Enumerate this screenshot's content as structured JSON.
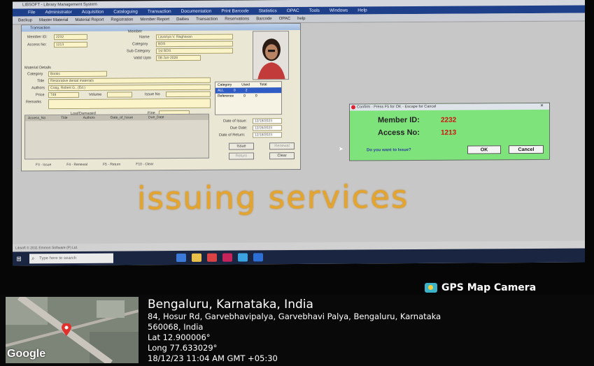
{
  "app": {
    "title": "LIBSOFT - Library Management System",
    "menu": [
      "File",
      "Administrator",
      "Acquisition",
      "Cataloguing",
      "Transaction",
      "Documentation",
      "Print Barcode",
      "Statistics",
      "OPAC",
      "Tools",
      "Windows",
      "Help"
    ],
    "toolbar": [
      "Backup",
      "Master Material",
      "Material Report",
      "Registration",
      "Member Report",
      "Dailies",
      "Transaction",
      "Reservations",
      "Barcode",
      "OPAC",
      "help"
    ],
    "status": "Libsoft © 2011 Emmon Software (P) Ltd."
  },
  "issue_window": {
    "title": "Transaction",
    "member_label": "Member",
    "member_id_label": "Member ID:",
    "member_id": "2232",
    "access_no_label": "Access No:",
    "access_no": "1213",
    "name_label": "Name",
    "name": "Lavanya V. Raghavan",
    "category_label": "Category",
    "category": "BDS",
    "subcategory_label": "Sub Category",
    "subcategory": "1st BDS",
    "valid_upto_label": "Valid Upto",
    "valid_upto": "08-Jun-2028",
    "material_details": "Material Details",
    "m_category_label": "Category",
    "m_category": "Books",
    "title_label": "Title",
    "book_title": "Restorative dental materials",
    "authors_label": "Authors",
    "authors": "Craig, Robert G., (Ed.)",
    "price_label": "Price",
    "price": "749",
    "volume_label": "Volume",
    "issue_no_label": "Issue No",
    "remarks_label": "Remarks",
    "lost_label": "Lost/Damaged",
    "fine_label": "Fine",
    "grid_headers": [
      "Access_No",
      "Title",
      "Authors",
      "Date_of_Issue",
      "Due_Date"
    ],
    "cat_headers": [
      "Category",
      "Used",
      "Total"
    ],
    "cat_rows": [
      [
        "ALL",
        "0",
        "2"
      ],
      [
        "Reference",
        "0",
        "0"
      ]
    ],
    "date_issue_label": "Date of Issue:",
    "date_issue": "12/18/2023",
    "due_date_label": "Due Date:",
    "due_date": "12/26/2023",
    "date_return_label": "Date of Return:",
    "date_return": "12/18/2023",
    "btn_issue": "Issue",
    "btn_renewal": "Renewal",
    "btn_return": "Return",
    "btn_clear": "Clear",
    "fkeys": [
      "F3 - Issue",
      "F4 - Renewal",
      "F5 - Return",
      "F10 - Clear"
    ]
  },
  "confirm": {
    "title": "Confirm - Press F5 for OK - Escape for Cancel",
    "member_id_label": "Member ID:",
    "member_id": "2232",
    "access_no_label": "Access No:",
    "access_no": "1213",
    "question": "Do you want to Issue?",
    "ok": "OK",
    "cancel": "Cancel"
  },
  "caption": "issuing services",
  "taskbar": {
    "search_placeholder": "Type here to search"
  },
  "gps": {
    "brand": "GPS Map Camera",
    "city": "Bengaluru, Karnataka, India",
    "address": "84, Hosur Rd, Garvebhavipalya, Garvebhavi Palya, Bengaluru, Karnataka",
    "postal": "560068, India",
    "lat": "Lat 12.900006°",
    "long": "Long 77.633029°",
    "datetime": "18/12/23 11:04 AM GMT +05:30",
    "map_logo": "Google"
  }
}
